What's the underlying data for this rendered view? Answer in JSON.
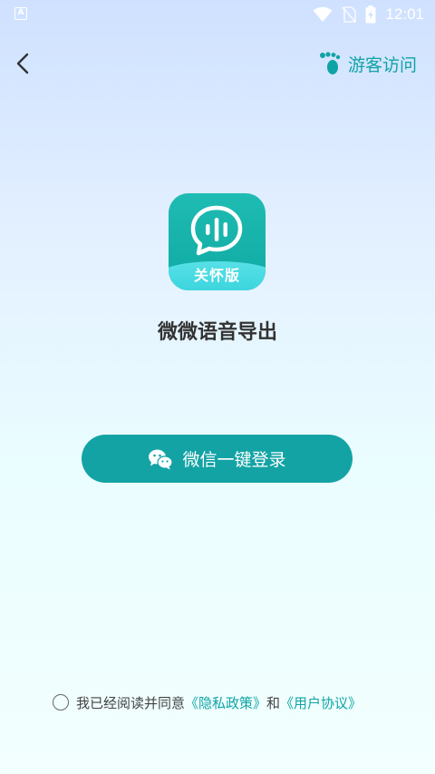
{
  "status_bar": {
    "left_indicator": "A",
    "time": "12:01"
  },
  "nav": {
    "guest_label": "游客访问"
  },
  "app": {
    "badge": "关怀版",
    "name": "微微语音导出"
  },
  "login": {
    "wechat_label": "微信一键登录"
  },
  "agreement": {
    "prefix": "我已经阅读并同意",
    "privacy_link": "《隐私政策》",
    "connector": "和",
    "user_link": "《用户协议》"
  },
  "colors": {
    "accent": "#13a3a5",
    "link": "#10a3a6"
  }
}
